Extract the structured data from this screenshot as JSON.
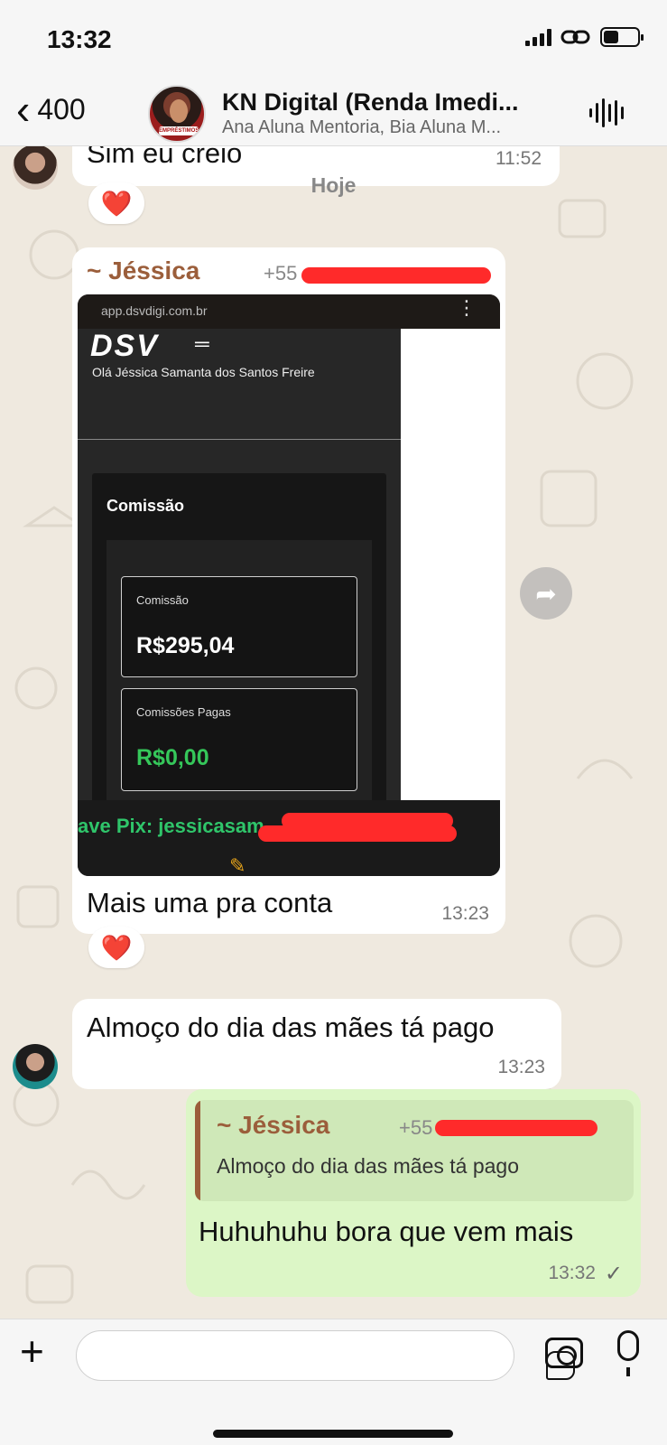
{
  "status": {
    "time": "13:32"
  },
  "header": {
    "back_count": "400",
    "title": "KN Digital (Renda Imedi...",
    "subtitle": "Ana Aluna Mentoria, Bia Aluna  M..."
  },
  "chat": {
    "day_label": "Hoje",
    "messages": [
      {
        "text": "Sim eu creio",
        "time": "11:52",
        "reaction": "❤️"
      },
      {
        "sender": "~ Jéssica",
        "phone": "+55",
        "image": {
          "url": "app.dsvdigi.com.br",
          "logo": "DSV",
          "greeting": "Olá Jéssica Samanta dos Santos Freire",
          "panel_title": "Comissão",
          "card1_label": "Comissão",
          "card1_value": "R$295,04",
          "card2_label": "Comissões Pagas",
          "card2_value": "R$0,00",
          "pix_text": "ave Pix:  jessicasam"
        },
        "caption": "Mais uma pra conta",
        "time": "13:23",
        "reaction": "❤️"
      },
      {
        "text": "Almoço do dia das mães tá pago",
        "time": "13:23"
      },
      {
        "quote_sender": "~ Jéssica",
        "quote_phone": "+55",
        "quote_text": "Almoço do dia das mães tá pago",
        "text": "Huhuhuhu bora que vem mais",
        "time": "13:32",
        "status": "✓"
      }
    ]
  }
}
